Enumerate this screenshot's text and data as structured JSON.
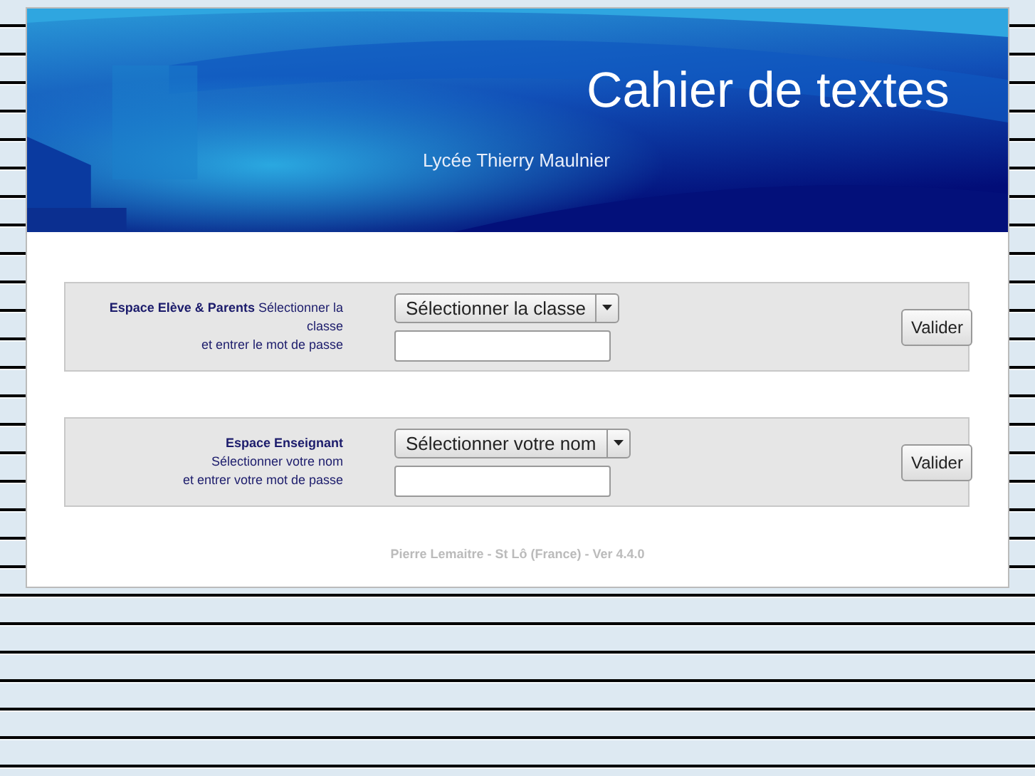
{
  "header": {
    "title": "Cahier de textes",
    "subtitle": "Lycée Thierry Maulnier"
  },
  "sections": [
    {
      "lines": [
        "**Espace Elève & Parents** Sélectionner la classe",
        "et entrer le mot de passe"
      ],
      "select": "Sélectionner la classe",
      "button": "Valider"
    },
    {
      "lines": [
        "**Espace Enseignant**",
        "Sélectionner votre nom",
        "et entrer votre mot de passe"
      ],
      "select": "Sélectionner votre nom",
      "button": "Valider"
    }
  ],
  "footer": "Pierre Lemaitre - St Lô (France) - Ver 4.4.0"
}
